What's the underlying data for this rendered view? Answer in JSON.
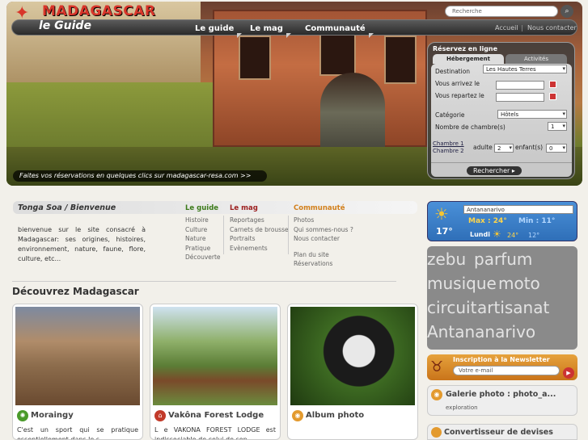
{
  "header": {
    "logo_title": "MADAGASCAR",
    "logo_sub": "le Guide",
    "nav": [
      "Le guide",
      "Le mag",
      "Communauté"
    ],
    "top_links": [
      "Accueil",
      "Nous contacter"
    ],
    "search_placeholder": "Recherche",
    "tagline": "Faites vos réservations en quelques clics sur madagascar-resa.com >>"
  },
  "booking": {
    "title": "Réservez en ligne",
    "tabs": [
      "Hébergement",
      "Activités"
    ],
    "destination_label": "Destination",
    "destination_value": "Les Hautes Terres",
    "arrive_label": "Vous arrivez le",
    "depart_label": "Vous repartez le",
    "category_label": "Catégorie",
    "category_value": "Hôtels",
    "rooms_label": "Nombre de chambre(s)",
    "rooms_value": "1",
    "room1": "Chambre 1",
    "room2": "Chambre 2",
    "adult_label": "adulte",
    "adult_value": "2",
    "child_label": "enfant(s)",
    "child_value": "0",
    "search_button": "Rechercher"
  },
  "welcome": {
    "title": "Tonga Soa / Bienvenue",
    "text": "bienvenue sur le site consacré à Madagascar: ses origines, histoires, environnement, nature, faune, flore, culture, etc...",
    "columns": [
      {
        "heading": "Le guide",
        "color": "#3b7a1a",
        "items": [
          "Histoire",
          "Culture",
          "Nature",
          "Pratique",
          "Découverte"
        ]
      },
      {
        "heading": "Le mag",
        "color": "#9b1d1d",
        "items": [
          "Reportages",
          "Carnets de brousse",
          "Portraits",
          "Evènements"
        ]
      },
      {
        "heading": "Communauté",
        "color": "#d2801d",
        "items": [
          "Photos",
          "Qui sommes-nous ?",
          "Nous contacter",
          "",
          "Plan du site",
          "Réservations"
        ]
      }
    ]
  },
  "discover": {
    "title": "Découvrez Madagascar",
    "cards": [
      {
        "title": "Moraingy",
        "icon": "star-icon",
        "icon_color": "#4a9a2a",
        "text": "C'est un sport qui se pratique essentiellement dans le s..."
      },
      {
        "title": "Vakôna Forest Lodge",
        "icon": "hotel-icon",
        "icon_color": "#c23a2a",
        "text": "L e VAKONA FOREST LODGE est indissociable de celui de son..."
      },
      {
        "title": "Album photo",
        "icon": "camera-icon",
        "icon_color": "#e39a2e",
        "text": ""
      }
    ]
  },
  "weather": {
    "city": "Antananarivo",
    "temp": "17°",
    "max": "Max : 24°",
    "min": "Min : 11°",
    "day": "Lundi",
    "day_max": "24°",
    "day_min": "12°"
  },
  "tags": [
    "zebu",
    "parfum",
    "musique",
    "moto",
    "circuit",
    "artisanat",
    "Antananarivo"
  ],
  "newsletter": {
    "title": "Inscription à la Newsletter",
    "placeholder": "Votre e-mail",
    "button": "▶"
  },
  "gallery": {
    "title": "Galerie photo : photo_a...",
    "sub": "exploration"
  },
  "converter": {
    "title": "Convertisseur de devises"
  }
}
